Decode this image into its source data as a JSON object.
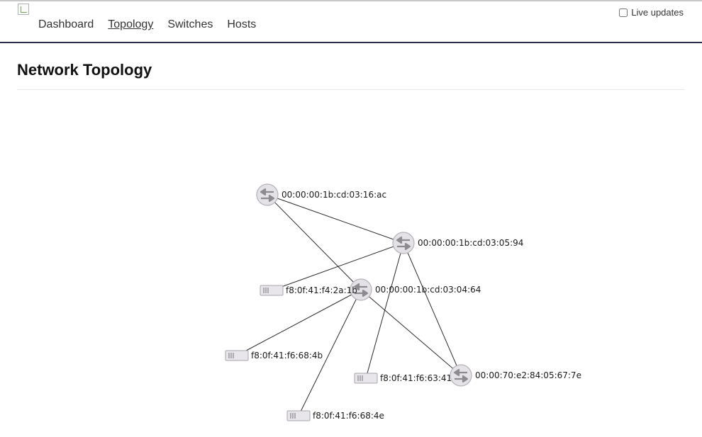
{
  "nav": {
    "items": [
      {
        "label": "Dashboard"
      },
      {
        "label": "Topology"
      },
      {
        "label": "Switches"
      },
      {
        "label": "Hosts"
      }
    ],
    "active": "Topology"
  },
  "live_updates": {
    "label": "Live updates",
    "checked": false
  },
  "page": {
    "title": "Network Topology"
  },
  "topology": {
    "switches": [
      {
        "id": "s1",
        "label": "00:00:00:1b:cd:03:16:ac"
      },
      {
        "id": "s2",
        "label": "00:00:00:1b:cd:03:05:94"
      },
      {
        "id": "s3",
        "label": "00:00:00:1b:cd:03:04:64"
      },
      {
        "id": "s4",
        "label": "00:00:70:e2:84:05:67:7e"
      }
    ],
    "hosts": [
      {
        "id": "h1",
        "label": "f8:0f:41:f4:2a:1b"
      },
      {
        "id": "h2",
        "label": "f8:0f:41:f6:68:4b"
      },
      {
        "id": "h3",
        "label": "f8:0f:41:f6:63:41"
      },
      {
        "id": "h4",
        "label": "f8:0f:41:f6:68:4e"
      }
    ],
    "links": [
      [
        "s1",
        "s2"
      ],
      [
        "s1",
        "s3"
      ],
      [
        "s2",
        "h1"
      ],
      [
        "s2",
        "h3"
      ],
      [
        "s2",
        "s4"
      ],
      [
        "s3",
        "h2"
      ],
      [
        "s3",
        "h4"
      ],
      [
        "s3",
        "s4"
      ]
    ]
  }
}
